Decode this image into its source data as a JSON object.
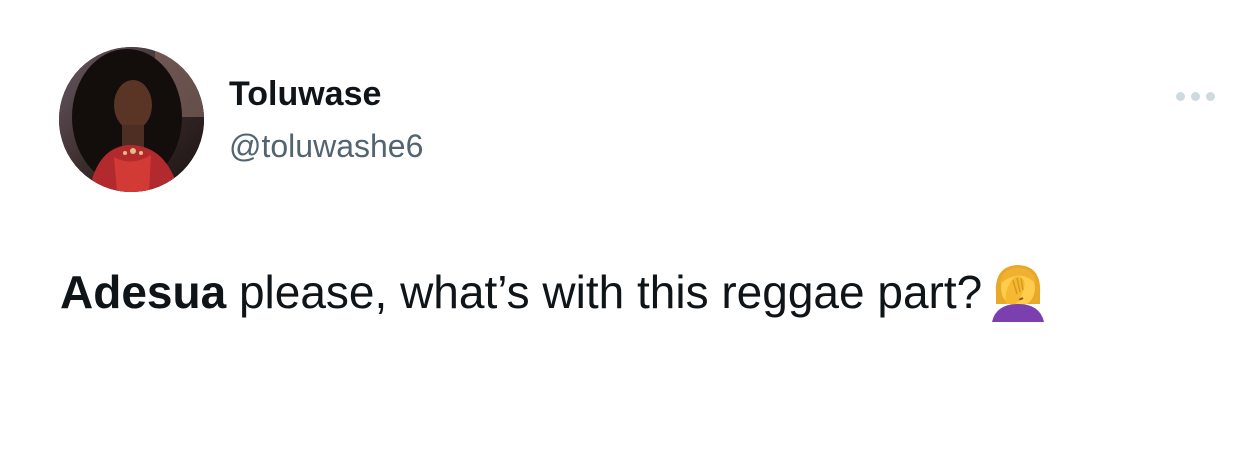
{
  "user": {
    "display_name": "Toluwase",
    "handle": "@toluwashe6"
  },
  "tweet": {
    "bold_word": "Adesua",
    "text_rest": " please, what’s with this reggae part?",
    "emoji_name": "woman-facepalming-emoji"
  },
  "icons": {
    "more": "more-dots-icon"
  },
  "colors": {
    "text_primary": "#0f1419",
    "text_secondary": "#536471",
    "dots": "#cfd9de"
  }
}
